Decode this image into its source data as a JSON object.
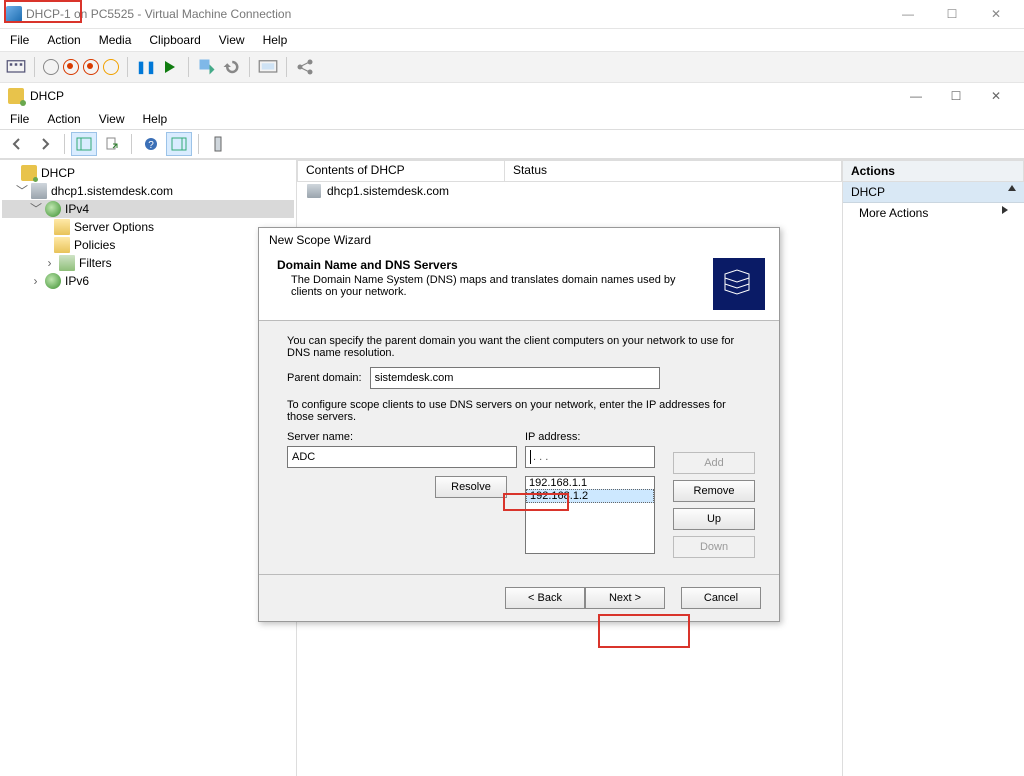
{
  "vm": {
    "title": "DHCP-1 on PC5525 - Virtual Machine Connection",
    "menu": [
      "File",
      "Action",
      "Media",
      "Clipboard",
      "View",
      "Help"
    ]
  },
  "mmc": {
    "title": "DHCP",
    "menu": [
      "File",
      "Action",
      "View",
      "Help"
    ],
    "tree": {
      "root": "DHCP",
      "server": "dhcp1.sistemdesk.com",
      "ipv4": "IPv4",
      "ipv4_children": [
        "Server Options",
        "Policies",
        "Filters"
      ],
      "ipv6": "IPv6"
    },
    "columns": {
      "c1": "Contents of DHCP",
      "c2": "Status"
    },
    "row1": "dhcp1.sistemdesk.com",
    "actions": {
      "header": "Actions",
      "section": "DHCP",
      "item": "More Actions"
    }
  },
  "wizard": {
    "title": "New Scope Wizard",
    "heading": "Domain Name and DNS Servers",
    "sub": "The Domain Name System (DNS) maps and translates domain names used by clients on your network.",
    "p1": "You can specify the parent domain you want the client computers on your network to use for DNS name resolution.",
    "parent_label": "Parent domain:",
    "parent_value": "sistemdesk.com",
    "p2": "To configure scope clients to use DNS servers on your network, enter the IP addresses for those servers.",
    "server_label": "Server name:",
    "server_value": "ADC",
    "ip_label": "IP address:",
    "ip_value": "   .       .       .",
    "resolve": "Resolve",
    "list": [
      "192.168.1.1",
      "192.168.1.2"
    ],
    "add": "Add",
    "remove": "Remove",
    "up": "Up",
    "down": "Down",
    "back": "< Back",
    "next": "Next >",
    "cancel": "Cancel"
  }
}
